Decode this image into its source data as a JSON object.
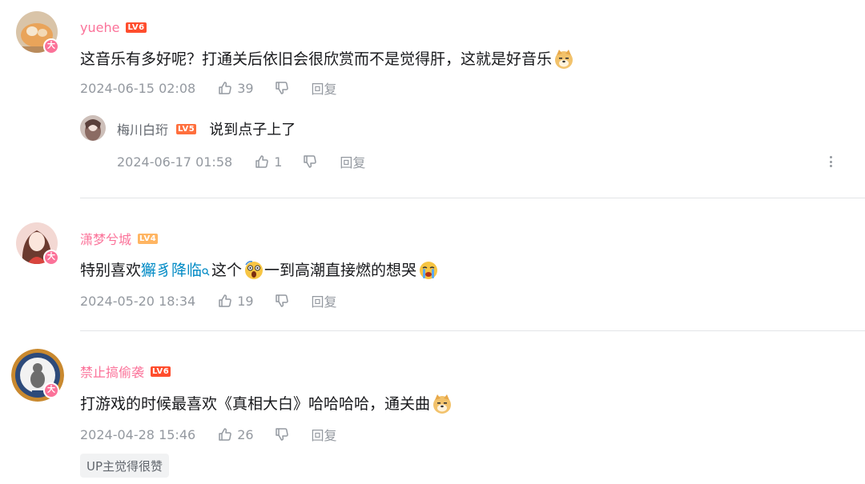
{
  "comments": [
    {
      "username": "yuehe",
      "level": "LV6",
      "vip_badge": "大",
      "text": "这音乐有多好呢？打通关后依旧会很欣赏而不是觉得肝，这就是好音乐",
      "emote": "doge-emote",
      "date": "2024-06-15 02:08",
      "likes": "39",
      "reply_label": "回复",
      "replies": [
        {
          "username": "梅川白珩",
          "level": "LV5",
          "text": "说到点子上了",
          "date": "2024-06-17 01:58",
          "likes": "1",
          "reply_label": "回复"
        }
      ]
    },
    {
      "username": "潇梦兮城",
      "level": "LV4",
      "vip_badge": "大",
      "text_before": "特别喜欢",
      "link_text": "獬豸降临",
      "text_middle": "这个",
      "text_after": "一到高潮直接燃的想哭",
      "date": "2024-05-20 18:34",
      "likes": "19",
      "reply_label": "回复"
    },
    {
      "username": "禁止搞偷袭",
      "level": "LV6",
      "vip_badge": "大",
      "text": "打游戏的时候最喜欢《真相大白》哈哈哈哈，通关曲",
      "date": "2024-04-28 15:46",
      "likes": "26",
      "reply_label": "回复",
      "up_tag": "UP主觉得很赞"
    }
  ],
  "colors": {
    "username": "#fb7299",
    "meta": "#9499a0",
    "link": "#008ac5",
    "lv6": "#ff4d2d",
    "lv5": "#ff6f3d",
    "lv4": "#ffb562"
  }
}
